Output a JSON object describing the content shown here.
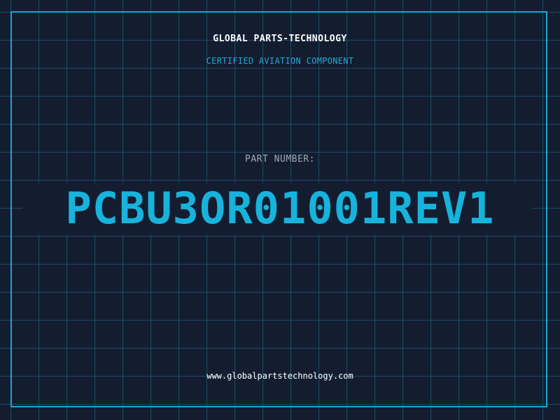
{
  "header": {
    "company": "GLOBAL PARTS-TECHNOLOGY",
    "subtitle": "CERTIFIED AVIATION COMPONENT"
  },
  "part": {
    "label": "PART NUMBER:",
    "number": "PCBU3OR01001REV1"
  },
  "footer": {
    "website": "www.globalpartstechnology.com"
  },
  "colors": {
    "background": "#141d30",
    "grid": "#206e8c",
    "accent": "#17b3dc",
    "frame": "#13a9d2"
  }
}
